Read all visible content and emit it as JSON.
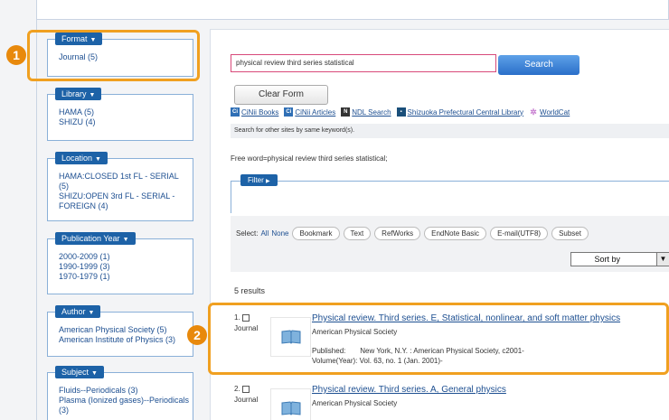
{
  "facets": [
    {
      "name": "format",
      "label": "Format",
      "items": [
        "Journal (5)"
      ]
    },
    {
      "name": "library",
      "label": "Library",
      "items": [
        "HAMA (5)",
        "SHIZU (4)"
      ]
    },
    {
      "name": "location",
      "label": "Location",
      "items": [
        "HAMA:CLOSED 1st FL - SERIAL",
        "(5)",
        "SHIZU:OPEN 3rd FL - SERIAL -",
        "FOREIGN (4)"
      ]
    },
    {
      "name": "publication-year",
      "label": "Publication Year",
      "items": [
        "2000-2009 (1)",
        "1990-1999 (3)",
        "1970-1979 (1)"
      ]
    },
    {
      "name": "author",
      "label": "Author",
      "items": [
        "American Physical Society (5)",
        "American Institute of Physics (3)"
      ]
    },
    {
      "name": "subject",
      "label": "Subject",
      "items": [
        "Fluids--Periodicals (3)",
        "Plasma (Ionized gases)--Periodicals",
        "(3)"
      ]
    }
  ],
  "badges": {
    "one": "1",
    "two": "2"
  },
  "search": {
    "value": "physical review third series statistical",
    "button": "Search",
    "clear": "Clear Form"
  },
  "ext_links": [
    {
      "icon": "ci-icon",
      "label": "CiNii Books",
      "color": "#2f6fb5"
    },
    {
      "icon": "ci-icon",
      "label": "CiNii Articles",
      "color": "#2f6fb5"
    },
    {
      "icon": "ndl-icon",
      "label": "NDL Search",
      "color": "#333333"
    },
    {
      "icon": "library-icon",
      "label": "Shizuoka Prefectural Central Library",
      "color": "#1a4f7a"
    },
    {
      "icon": "worldcat-icon",
      "label": "WorldCat",
      "color": "#c77dd0"
    }
  ],
  "other_sites": "Search for other sites by same keyword(s).",
  "freeword": "Free word=physical review third series statistical;",
  "filter_label": "Filter",
  "select": {
    "label": "Select:",
    "all": "All",
    "none": "None",
    "actions": [
      "Bookmark",
      "Text",
      "RefWorks",
      "EndNote Basic",
      "E-mail(UTF8)",
      "Subset"
    ]
  },
  "sort": {
    "selected": "Sort by"
  },
  "results_count": "5 results",
  "results": [
    {
      "num": "1.",
      "kind": "Journal",
      "title": "Physical review. Third series. E, Statistical, nonlinear, and soft matter physics",
      "publisher": "American Physical Society",
      "published_key": "Published:",
      "published": "New York, N.Y. : American Physical Society, c2001-",
      "volume_key": "Volume(Year):",
      "volume": "Vol. 63, no. 1 (Jan. 2001)-"
    },
    {
      "num": "2.",
      "kind": "Journal",
      "title": "Physical review. Third series. A, General physics",
      "publisher": "American Physical Society"
    }
  ],
  "colors": {
    "accent": "#1d62a7",
    "highlight": "#f0a020",
    "badge": "#e8890c"
  }
}
